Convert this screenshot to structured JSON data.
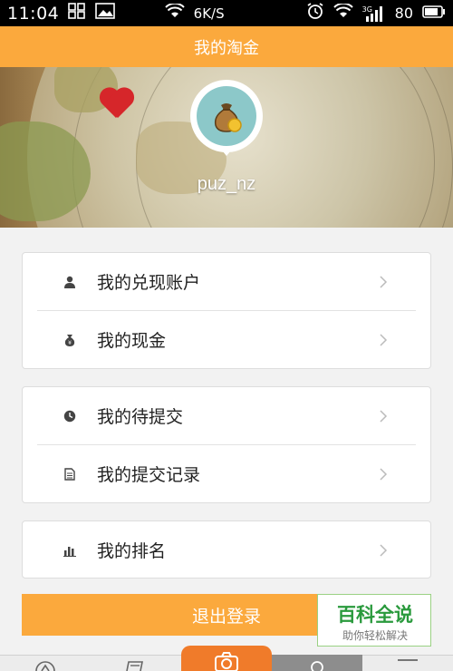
{
  "status_bar": {
    "time": "11:04",
    "network_speed": "6K/S",
    "signal_label": "3G",
    "battery_level": "80"
  },
  "header": {
    "title": "我的淘金"
  },
  "profile": {
    "username": "puz_nz",
    "avatar_icon": "money-bag-icon"
  },
  "menu_groups": [
    {
      "items": [
        {
          "label": "我的兑现账户",
          "icon": "person-icon"
        },
        {
          "label": "我的现金",
          "icon": "cash-bag-icon"
        }
      ]
    },
    {
      "items": [
        {
          "label": "我的待提交",
          "icon": "clock-icon"
        },
        {
          "label": "我的提交记录",
          "icon": "document-icon"
        }
      ]
    },
    {
      "items": [
        {
          "label": "我的排名",
          "icon": "bar-chart-icon"
        }
      ]
    }
  ],
  "logout": {
    "label": "退出登录"
  },
  "watermark": {
    "title": "百科全说",
    "subtitle": "助你轻松解决"
  },
  "colors": {
    "accent": "#fba93d",
    "nav_active": "#f07b2a",
    "watermark_green": "#2a9a3d"
  }
}
